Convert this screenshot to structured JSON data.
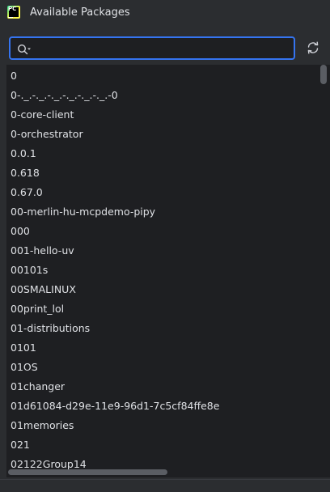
{
  "header": {
    "title": "Available Packages",
    "app_icon": "pycharm-icon"
  },
  "search": {
    "value": "",
    "placeholder": "",
    "icon": "search-icon"
  },
  "refresh": {
    "icon": "refresh-icon"
  },
  "packages": [
    "0",
    "0-._.-._.-._.-._.-._.-._.-0",
    "0-core-client",
    "0-orchestrator",
    "0.0.1",
    "0.618",
    "0.67.0",
    "00-merlin-hu-mcpdemo-pipy",
    "000",
    "001-hello-uv",
    "00101s",
    "00SMALINUX",
    "00print_lol",
    "01-distributions",
    "0101",
    "01OS",
    "01changer",
    "01d61084-d29e-11e9-96d1-7c5cf84ffe8e",
    "01memories",
    "021",
    "02122Group14"
  ],
  "colors": {
    "background": "#2b2d30",
    "list_background": "#1e1f22",
    "accent": "#3574f0",
    "text": "#dfe1e5"
  }
}
